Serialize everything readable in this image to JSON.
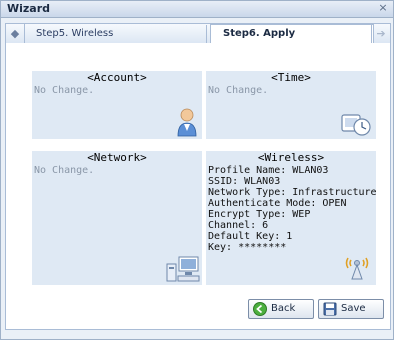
{
  "window": {
    "title": "Wizard",
    "close_glyph": "×"
  },
  "tabs": {
    "left_arrow": "◆",
    "right_arrow": "➔",
    "items": [
      {
        "label": "Step5. Wireless",
        "active": false
      },
      {
        "label": "Step6. Apply",
        "active": true
      }
    ]
  },
  "panels": {
    "account": {
      "title": "<Account>",
      "text": "No Change.",
      "icon": "user-icon"
    },
    "time": {
      "title": "<Time>",
      "text": "No Change.",
      "icon": "clock-icon"
    },
    "network": {
      "title": "<Network>",
      "text": "No Change.",
      "icon": "network-computers-icon"
    },
    "wireless": {
      "title": "<Wireless>",
      "lines": [
        "Profile Name: WLAN03",
        "SSID: WLAN03",
        "Network Type: Infrastructure",
        "Authenticate Mode: OPEN",
        "Encrypt Type: WEP",
        "Channel: 6",
        "Default Key: 1",
        "Key: ********"
      ],
      "icon": "wireless-antenna-icon"
    }
  },
  "buttons": {
    "back": {
      "label": "Back",
      "icon": "back-arrow-icon"
    },
    "save": {
      "label": "Save",
      "icon": "floppy-disk-icon"
    }
  },
  "colors": {
    "panel_bg": "#dfe9f4",
    "accent": "#9fb1c8"
  }
}
